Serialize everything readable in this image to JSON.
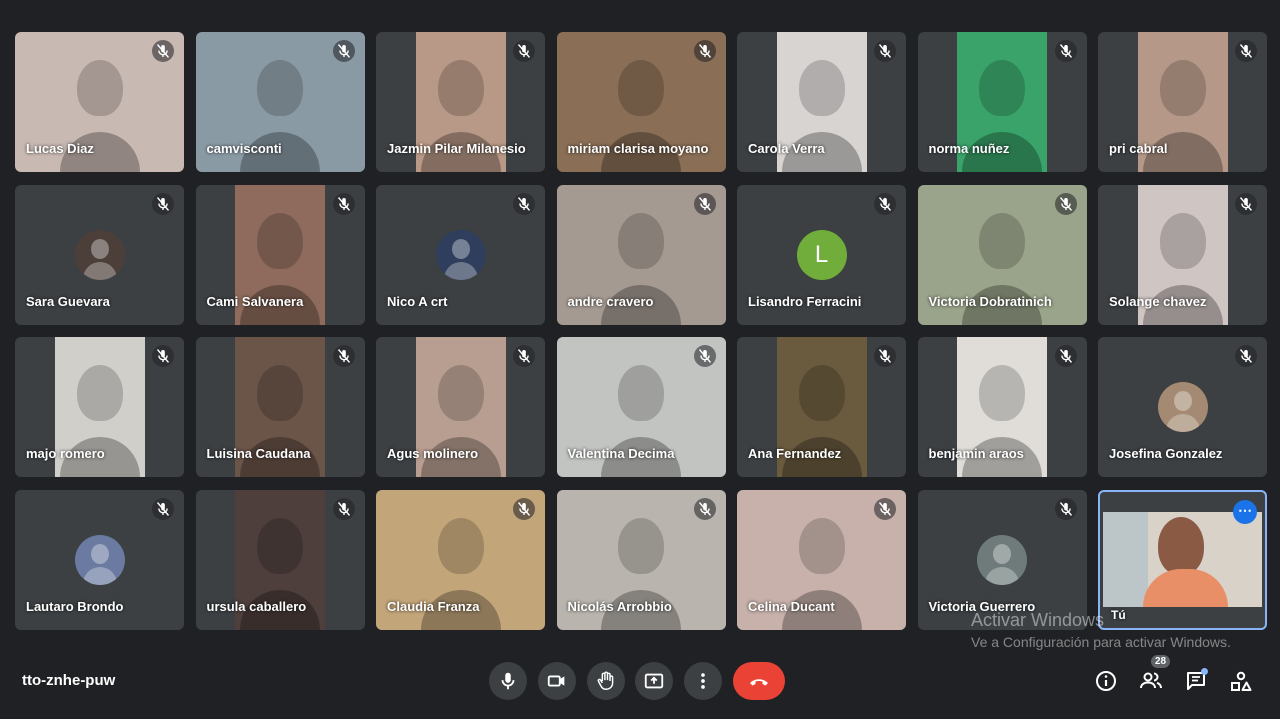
{
  "meeting": {
    "code": "tto-znhe-puw"
  },
  "participants": [
    {
      "name": "Lucas Diaz",
      "kind": "video",
      "color": "#c9b9b3"
    },
    {
      "name": "camvisconti",
      "kind": "video",
      "color": "#8a9aa4"
    },
    {
      "name": "Jazmin Pilar Milanesio",
      "kind": "video",
      "color": "#b89886"
    },
    {
      "name": "miriam clarisa moyano",
      "kind": "video",
      "color": "#8a6e55"
    },
    {
      "name": "Carola Verra",
      "kind": "video",
      "color": "#d7d4d2"
    },
    {
      "name": "norma nuñez",
      "kind": "video",
      "color": "#3aa36a"
    },
    {
      "name": "pri cabral",
      "kind": "video",
      "color": "#b59888"
    },
    {
      "name": "Sara Guevara",
      "kind": "avatar",
      "color": "#4c3f3a"
    },
    {
      "name": "Cami Salvanera",
      "kind": "video",
      "color": "#8e6b5c"
    },
    {
      "name": "Nico A crt",
      "kind": "avatar",
      "color": "#2f3e5c"
    },
    {
      "name": "andre cravero",
      "kind": "video",
      "color": "#a59a92"
    },
    {
      "name": "Lisandro Ferracini",
      "kind": "letter",
      "letter": "L",
      "color": "#70ad3a"
    },
    {
      "name": "Victoria Dobratinich",
      "kind": "video",
      "color": "#9aa48a"
    },
    {
      "name": "Solange chavez",
      "kind": "video",
      "color": "#cfc5c2"
    },
    {
      "name": "majo romero",
      "kind": "video",
      "color": "#d1cfca"
    },
    {
      "name": "Luisina Caudana",
      "kind": "video",
      "color": "#6b5448"
    },
    {
      "name": "Agus molinero",
      "kind": "video",
      "color": "#b79e90"
    },
    {
      "name": "Valentina Decima",
      "kind": "video",
      "color": "#c2c4c1"
    },
    {
      "name": "Ana Fernandez",
      "kind": "video",
      "color": "#6a5a3e"
    },
    {
      "name": "benjamin araos",
      "kind": "video",
      "color": "#e0ddd8"
    },
    {
      "name": "Josefina Gonzalez",
      "kind": "avatar",
      "color": "#a48a72"
    },
    {
      "name": "Lautaro Brondo",
      "kind": "avatar",
      "color": "#6a7aa0"
    },
    {
      "name": "ursula caballero",
      "kind": "video",
      "color": "#4e3f3c"
    },
    {
      "name": "Claudia Franza",
      "kind": "video",
      "color": "#c3a57a"
    },
    {
      "name": "Nicolás Arrobbio",
      "kind": "video",
      "color": "#b9b5ae"
    },
    {
      "name": "Celina Ducant",
      "kind": "video",
      "color": "#c7b1aa"
    },
    {
      "name": "Victoria Guerrero",
      "kind": "avatar",
      "color": "#6e7b7a"
    },
    {
      "name": "Tú",
      "kind": "self",
      "color": "#e98f68"
    }
  ],
  "watermark": {
    "title": "Activar Windows",
    "subtitle": "Ve a Configuración para activar Windows."
  },
  "controls": {
    "people_count": "28"
  },
  "icons": [
    "mic-icon",
    "camera-icon",
    "raise-hand-icon",
    "present-screen-icon",
    "more-options-icon",
    "end-call-icon",
    "info-icon",
    "people-icon",
    "chat-icon",
    "activities-icon",
    "mic-off-icon",
    "more-horizontal-icon"
  ],
  "colors": {
    "background": "#202124",
    "tile": "#3c4043",
    "end_call": "#ea4335",
    "accent": "#8ab4f8"
  }
}
